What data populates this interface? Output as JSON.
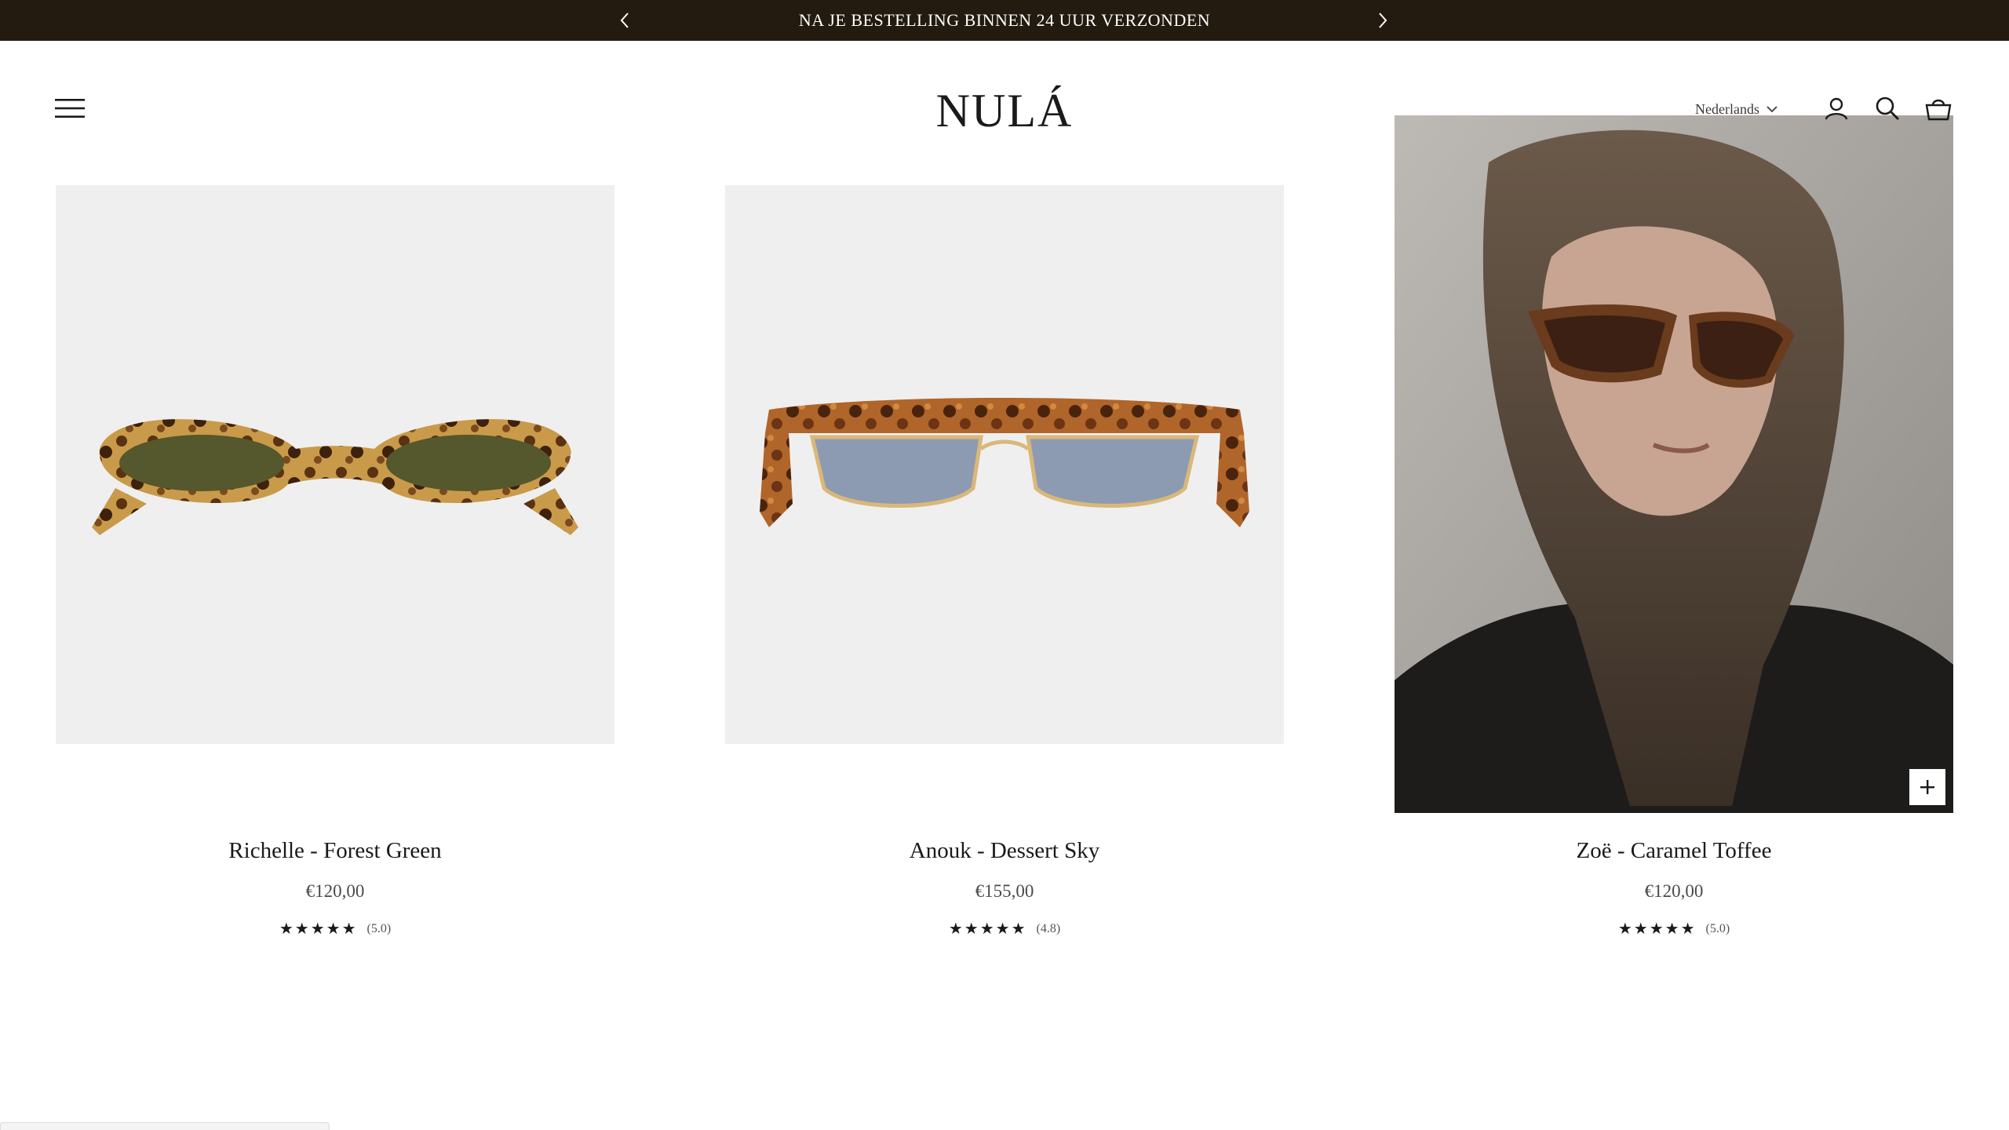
{
  "announcement": {
    "text": "NA JE BESTELLING BINNEN 24 UUR VERZONDEN",
    "prev_icon": "chevron-left-icon",
    "next_icon": "chevron-right-icon"
  },
  "header": {
    "logo": "NULÁ",
    "menu_icon": "hamburger-menu-icon",
    "language": "Nederlands",
    "icons": [
      "account-icon",
      "search-icon",
      "cart-icon"
    ]
  },
  "products": [
    {
      "title": "Richelle - Forest Green",
      "price": "€120,00",
      "stars": "★★★★★",
      "rating": "(5.0)"
    },
    {
      "title": "Anouk - Dessert Sky",
      "price": "€155,00",
      "stars": "★★★★★",
      "rating": "(4.8)"
    },
    {
      "title": "Zoë - Caramel Toffee",
      "price": "€120,00",
      "stars": "★★★★★",
      "rating": "(5.0)"
    }
  ],
  "colors": {
    "announcement_bg": "#231b10",
    "card_bg": "#efefef",
    "text": "#1a1a1a"
  }
}
